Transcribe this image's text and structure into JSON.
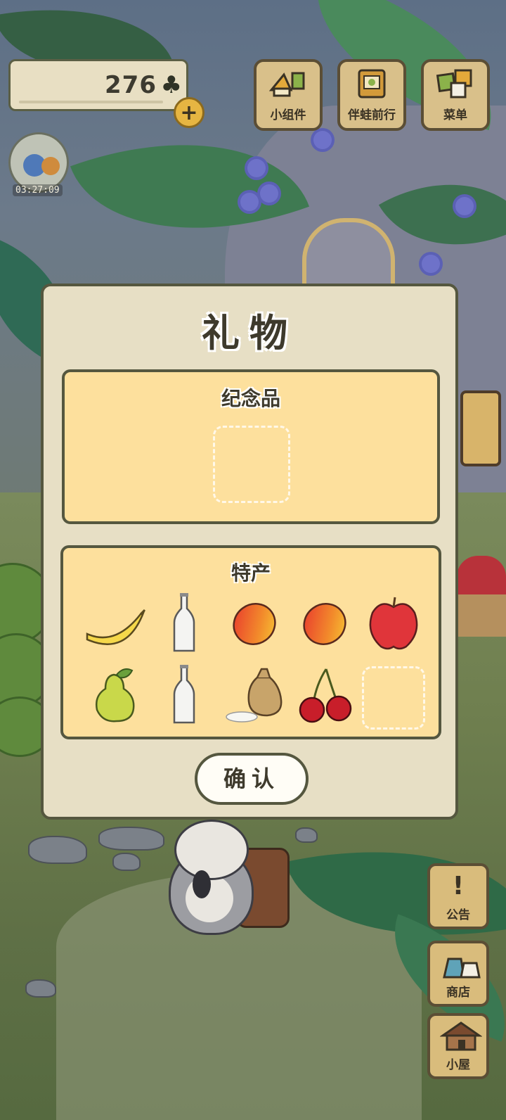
{
  "hud": {
    "clover_count": "276",
    "clover_icon": "clover-icon",
    "plus_label": "+",
    "timer": "03:27:09"
  },
  "top_buttons": [
    {
      "label": "小组件",
      "icon": "widget-icon"
    },
    {
      "label": "伴蛙前行",
      "icon": "journey-icon"
    },
    {
      "label": "菜单",
      "icon": "menu-icon"
    }
  ],
  "side_buttons": [
    {
      "label": "公告",
      "icon": "exclamation-icon",
      "glyph": "!"
    },
    {
      "label": "商店",
      "icon": "shop-bags-icon",
      "glyph": ""
    },
    {
      "label": "小屋",
      "icon": "house-icon",
      "glyph": ""
    }
  ],
  "dialog": {
    "title": "礼物",
    "souvenir": {
      "title": "纪念品",
      "items": []
    },
    "specialty": {
      "title": "特产",
      "items": [
        {
          "name": "banana",
          "icon": "banana-icon"
        },
        {
          "name": "bottle",
          "icon": "bottle-icon"
        },
        {
          "name": "mango",
          "icon": "mango-icon"
        },
        {
          "name": "mango",
          "icon": "mango-icon"
        },
        {
          "name": "apple",
          "icon": "apple-icon"
        },
        {
          "name": "pear",
          "icon": "pear-icon"
        },
        {
          "name": "bottle",
          "icon": "bottle-icon"
        },
        {
          "name": "rice-sack",
          "icon": "rice-sack-icon"
        },
        {
          "name": "cherries",
          "icon": "cherries-icon"
        }
      ]
    },
    "confirm_label": "确认"
  },
  "colors": {
    "panel_fill": "#fde09d",
    "dialog_fill": "#e7dfc5",
    "border": "#55573f",
    "button_wood": "#d9c08a"
  }
}
